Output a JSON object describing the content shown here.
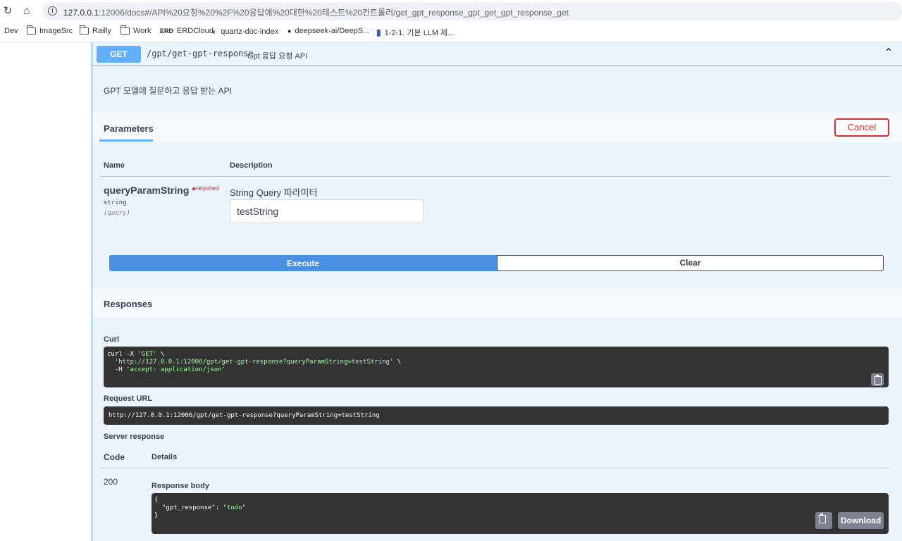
{
  "browser": {
    "url_host": "127.0.0.1",
    "url_rest": ":12006/docs#/API%20요청%20%2F%20응답에%20대한%20테스트%20컨트롤러/get_gpt_response_gpt_get_gpt_response_get",
    "bookmarks": [
      {
        "label": "Dev",
        "icon": "none"
      },
      {
        "label": "ImageSrc",
        "icon": "folder-icon"
      },
      {
        "label": "Railly",
        "icon": "folder-icon"
      },
      {
        "label": "Work",
        "icon": "folder-icon"
      },
      {
        "label": "ERDCloud",
        "icon": "erd-icon"
      },
      {
        "label": "quartz-doc-index",
        "icon": "globe-icon"
      },
      {
        "label": "deepseek-ai/DeepS...",
        "icon": "github-icon"
      },
      {
        "label": "1-2-1. 기본 LLM 제...",
        "icon": "book-icon"
      }
    ]
  },
  "operation": {
    "method": "GET",
    "path": "/gpt/get-gpt-response",
    "summary": "Gpt 응답 요청 API",
    "description": "GPT 모델에 질문하고 응답 받는 API"
  },
  "parameters": {
    "tab_label": "Parameters",
    "cancel_label": "Cancel",
    "col_name": "Name",
    "col_description": "Description",
    "param": {
      "name": "queryParamString",
      "star": "*",
      "required": "required",
      "type": "string",
      "in": "(query)",
      "description": "String Query 파라미터",
      "value": "testString"
    },
    "execute_label": "Execute",
    "clear_label": "Clear"
  },
  "responses": {
    "title": "Responses",
    "curl_label": "Curl",
    "curl_lines": [
      {
        "pre": "curl -X ",
        "str": "'GET'",
        "post": " \\"
      },
      {
        "pre": "  ",
        "str": "'http://127.0.0.1:12006/gpt/get-gpt-response?queryParamString=testString'",
        "post": " \\"
      },
      {
        "pre": "  -H ",
        "str": "'accept: application/json'",
        "post": ""
      }
    ],
    "request_url_label": "Request URL",
    "request_url": "http://127.0.0.1:12006/gpt/get-gpt-response?queryParamString=testString",
    "server_response_label": "Server response",
    "col_code": "Code",
    "col_details": "Details",
    "code": "200",
    "response_body_label": "Response body",
    "body_lines": [
      {
        "pre": "{",
        "key": "",
        "str": ""
      },
      {
        "pre": "  ",
        "key": "\"gpt_response\": ",
        "str": "\"todo\""
      },
      {
        "pre": "}",
        "key": "",
        "str": ""
      }
    ],
    "download_label": "Download"
  },
  "colors": {
    "get": "#61affe",
    "execute": "#4990e2",
    "cancel": "#d32f2f",
    "code_bg": "#333333",
    "code_string": "#a2fca2"
  }
}
